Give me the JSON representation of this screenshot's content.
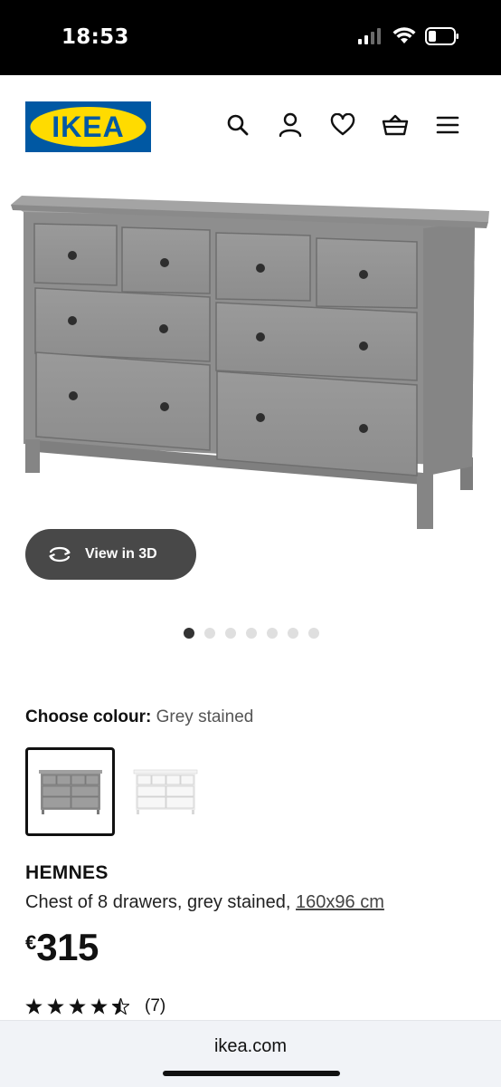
{
  "status_bar": {
    "time": "18:53",
    "icons": [
      "cellular-signal-icon",
      "wifi-icon",
      "battery-icon"
    ]
  },
  "header": {
    "logo_text": "IKEA",
    "brand_colors": {
      "blue": "#0058a3",
      "yellow": "#ffdb00"
    },
    "icons": [
      "search-icon",
      "account-icon",
      "wishlist-heart-icon",
      "shopping-basket-icon",
      "menu-icon"
    ]
  },
  "gallery": {
    "view_3d_label": "View in 3D",
    "image_count": 7,
    "active_image_index": 0
  },
  "colour": {
    "label": "Choose colour:",
    "selected_value": "Grey stained",
    "options": [
      "Grey stained",
      "White stain"
    ]
  },
  "product": {
    "name": "HEMNES",
    "description": "Chest of 8 drawers, grey stained,",
    "size": "160x96 cm",
    "currency": "€",
    "price": "315",
    "rating": 4.5,
    "rating_count": "(7)"
  },
  "browser": {
    "url": "ikea.com"
  }
}
